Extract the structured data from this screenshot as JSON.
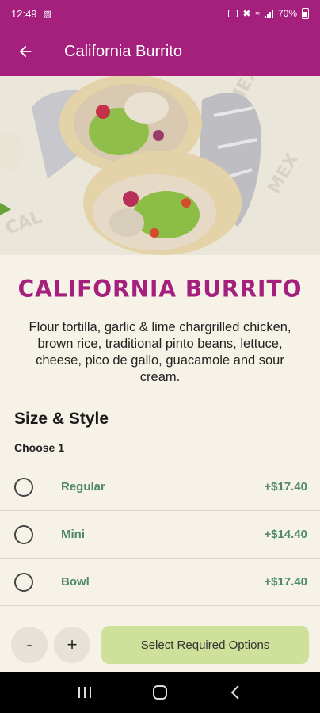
{
  "status": {
    "time": "12:49",
    "battery": "70%"
  },
  "appbar": {
    "title": "California Burrito",
    "back_icon": "arrow-left-icon"
  },
  "colors": {
    "brand": "#a5207c",
    "accent_green": "#4f8a6a",
    "cta_bg": "#cfe09a",
    "background": "#f6f2e8"
  },
  "product": {
    "name": "CALIFORNIA BURRITO",
    "description": "Flour tortilla, garlic & lime chargrilled chicken, brown rice, traditional pinto beans, lettuce, cheese, pico de gallo, guacamole and sour cream."
  },
  "size_style": {
    "title": "Size & Style",
    "subtitle": "Choose 1",
    "options": [
      {
        "label": "Regular",
        "price": "+$17.40"
      },
      {
        "label": "Mini",
        "price": "+$14.40"
      },
      {
        "label": "Bowl",
        "price": "+$17.40"
      }
    ]
  },
  "bottom": {
    "minus": "-",
    "plus": "+",
    "cta": "Select Required Options"
  },
  "nav": {
    "recent_icon": "recent-apps-icon",
    "home_icon": "home-icon",
    "back_icon": "back-icon"
  }
}
